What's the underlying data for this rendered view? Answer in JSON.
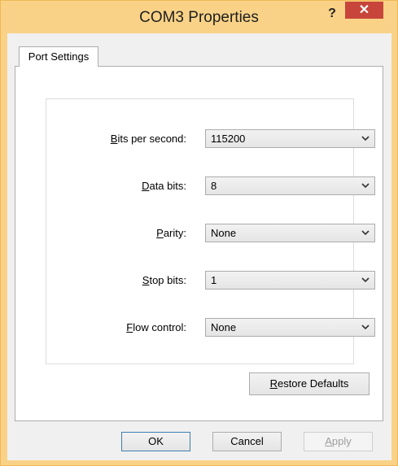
{
  "window": {
    "title": "COM3 Properties",
    "help_label": "?",
    "close_label": "✕"
  },
  "tabs": [
    {
      "label": "Port Settings",
      "selected": true
    }
  ],
  "fields": [
    {
      "label_pre": "",
      "label_mnemonic": "B",
      "label_post": "its per second:",
      "value": "115200"
    },
    {
      "label_pre": "",
      "label_mnemonic": "D",
      "label_post": "ata bits:",
      "value": "8"
    },
    {
      "label_pre": "",
      "label_mnemonic": "P",
      "label_post": "arity:",
      "value": "None"
    },
    {
      "label_pre": "",
      "label_mnemonic": "S",
      "label_post": "top bits:",
      "value": "1"
    },
    {
      "label_pre": "",
      "label_mnemonic": "F",
      "label_post": "low control:",
      "value": "None"
    }
  ],
  "restore_button": {
    "mnemonic": "R",
    "rest": "estore Defaults"
  },
  "footer": {
    "ok_label": "OK",
    "cancel_label": "Cancel",
    "apply_mnemonic": "A",
    "apply_rest": "pply"
  },
  "colors": {
    "titlebar": "#f9d287",
    "close_button": "#c7453a",
    "dialog_background": "#f0f0f0"
  }
}
